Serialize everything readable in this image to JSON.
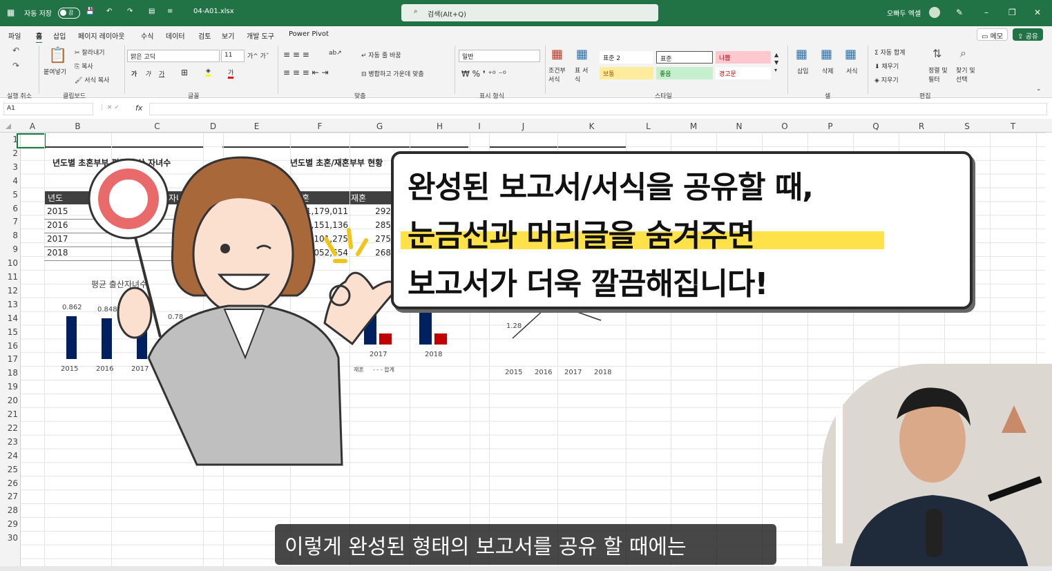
{
  "titlebar": {
    "autosave_label": "자동 저장",
    "autosave_state": "끔",
    "filename": "04-A01.xlsx",
    "search_placeholder": "검색(Alt+Q)",
    "user": "오빠두 엑셀",
    "bg_color": "#217346"
  },
  "menu": {
    "tabs": [
      "파일",
      "홈",
      "삽입",
      "페이지 레이아웃",
      "수식",
      "데이터",
      "검토",
      "보기",
      "개발 도구",
      "Power Pivot"
    ],
    "active_tab": "홈",
    "memo_label": "메모",
    "share_label": "공유"
  },
  "ribbon": {
    "undo_group": "실행 취소",
    "paste_label": "붙여넣기",
    "cut_label": "잘라내기",
    "copy_label": "복사",
    "format_painter_label": "서식 복사",
    "clipboard_group": "클립보드",
    "font_name": "맑은 고딕",
    "font_size": "11",
    "font_group": "글꼴",
    "wrap_label": "자동 줄 바꿈",
    "merge_label": "병합하고 가운데 맞춤",
    "align_group": "맞춤",
    "number_format": "일반",
    "number_group": "표시 형식",
    "cond_format_label": "조건부 서식",
    "table_format_label": "표 서식",
    "styles": {
      "standard2": "표준 2",
      "standard": "표준",
      "bad": "나쁨",
      "neutral": "보통",
      "good": "좋음",
      "warning": "경고문"
    },
    "styles_group": "스타일",
    "insert_label": "삽입",
    "delete_label": "삭제",
    "format_label": "서식",
    "cells_group": "셀",
    "autosum_label": "자동 합계",
    "fill_label": "채우기",
    "clear_label": "지우기",
    "sort_label": "정렬 및 필터",
    "find_label": "찾기 및 선택",
    "edit_group": "편집"
  },
  "formula_bar": {
    "name_box": "A1",
    "fx": "fx",
    "content": ""
  },
  "grid": {
    "columns": [
      "A",
      "B",
      "C",
      "D",
      "E",
      "F",
      "G",
      "H",
      "I",
      "J",
      "K",
      "L",
      "M",
      "N",
      "O",
      "P",
      "Q",
      "R",
      "S",
      "T"
    ],
    "rows": [
      "1",
      "2",
      "3",
      "4",
      "5",
      "6",
      "7",
      "8",
      "9",
      "10",
      "11",
      "12",
      "13",
      "14",
      "15",
      "16",
      "17",
      "18",
      "19",
      "20",
      "21",
      "22",
      "23",
      "24",
      "25",
      "26",
      "27",
      "28",
      "29",
      "30"
    ]
  },
  "sheet": {
    "table1_title": "년도별 초혼부부 평균 출산 자녀수",
    "table1_header_year": "년도",
    "table1_header_count": "자녀수",
    "years": [
      "2015",
      "2016",
      "2017",
      "2018"
    ],
    "table2_title": "년도별 초혼/재혼부부 현황",
    "table2_header_first": "초혼",
    "table2_header_re": "재혼",
    "first_marriage": [
      "1,179,011",
      "1,151,136",
      "1,101,275",
      "1,052,654"
    ],
    "remarriage": [
      "292",
      "285",
      "275",
      "268"
    ],
    "chart1_title": "평균 출산자녀수",
    "chart3_label": "1.28"
  },
  "chart_data": [
    {
      "type": "bar",
      "title": "평균 출산자녀수",
      "categories": [
        "2015",
        "2016",
        "2017",
        "2018"
      ],
      "values": [
        0.862,
        0.848,
        0.81,
        0.78
      ],
      "labels": [
        "0.862",
        "0.848",
        "",
        "0.78"
      ]
    },
    {
      "type": "bar",
      "categories": [
        "2015",
        "2016",
        "2017",
        "2018"
      ],
      "series": [
        {
          "name": "재혼",
          "values": [
            292,
            285,
            275,
            268
          ]
        },
        {
          "name": "합계",
          "values": [
            1179011,
            1151136,
            1101275,
            1052654
          ]
        }
      ]
    },
    {
      "type": "line",
      "categories": [
        "2015",
        "2016",
        "2017",
        "2018"
      ],
      "values": [
        1.28,
        1.4,
        1.45,
        1.4
      ],
      "labels": [
        "1.28",
        "",
        "",
        ""
      ]
    }
  ],
  "callout": {
    "line1": "완성된 보고서/서식을 공유할 때,",
    "line2": "눈금선과 머리글을 숨겨주면",
    "line3": "보고서가 더욱 깔끔해집니다!"
  },
  "subtitle": "이렇게 완성된 형태의 보고서를 공유 할 때에는"
}
